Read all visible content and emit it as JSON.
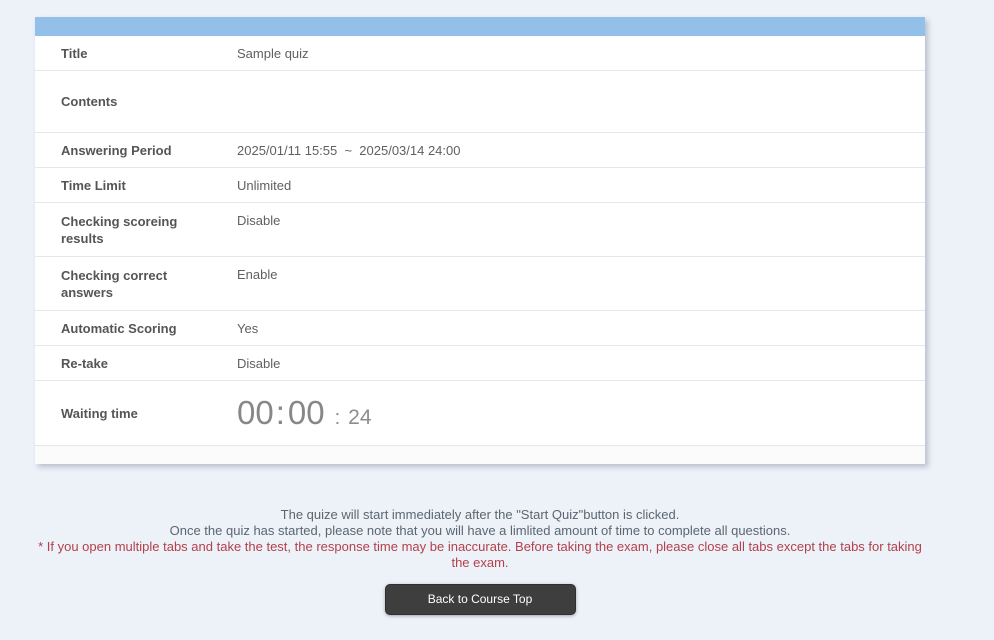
{
  "panel": {
    "header_color": "#93c0e8",
    "rows": [
      {
        "label": "Title",
        "value": "Sample quiz"
      },
      {
        "label": "Contents",
        "value": ""
      },
      {
        "label": "Answering Period",
        "value": "2025/01/11 15:55  ~  2025/03/14 24:00"
      },
      {
        "label": "Time Limit",
        "value": "Unlimited"
      },
      {
        "label": "Checking scoreing results",
        "value": "Disable"
      },
      {
        "label": "Checking correct answers",
        "value": "Enable"
      },
      {
        "label": "Automatic Scoring",
        "value": "Yes"
      },
      {
        "label": "Re-take",
        "value": "Disable"
      },
      {
        "label": "Waiting time",
        "value": ""
      }
    ],
    "timer": {
      "hours": "00",
      "minutes": "00",
      "seconds": "24",
      "colon": ":"
    }
  },
  "footer": {
    "line1": "The quize will start immediately after the \"Start Quiz\"button is clicked.",
    "line2": "Once the quiz has started, please note that you will have a limlited amount of time to complete all questions.",
    "warning": "* If you open multiple tabs and take the test, the response time may be inaccurate. Before taking the exam, please close all tabs except the tabs for taking the exam.",
    "warning_color": "#b2414b"
  },
  "actions": {
    "back_button_label": "Back to Course Top"
  }
}
